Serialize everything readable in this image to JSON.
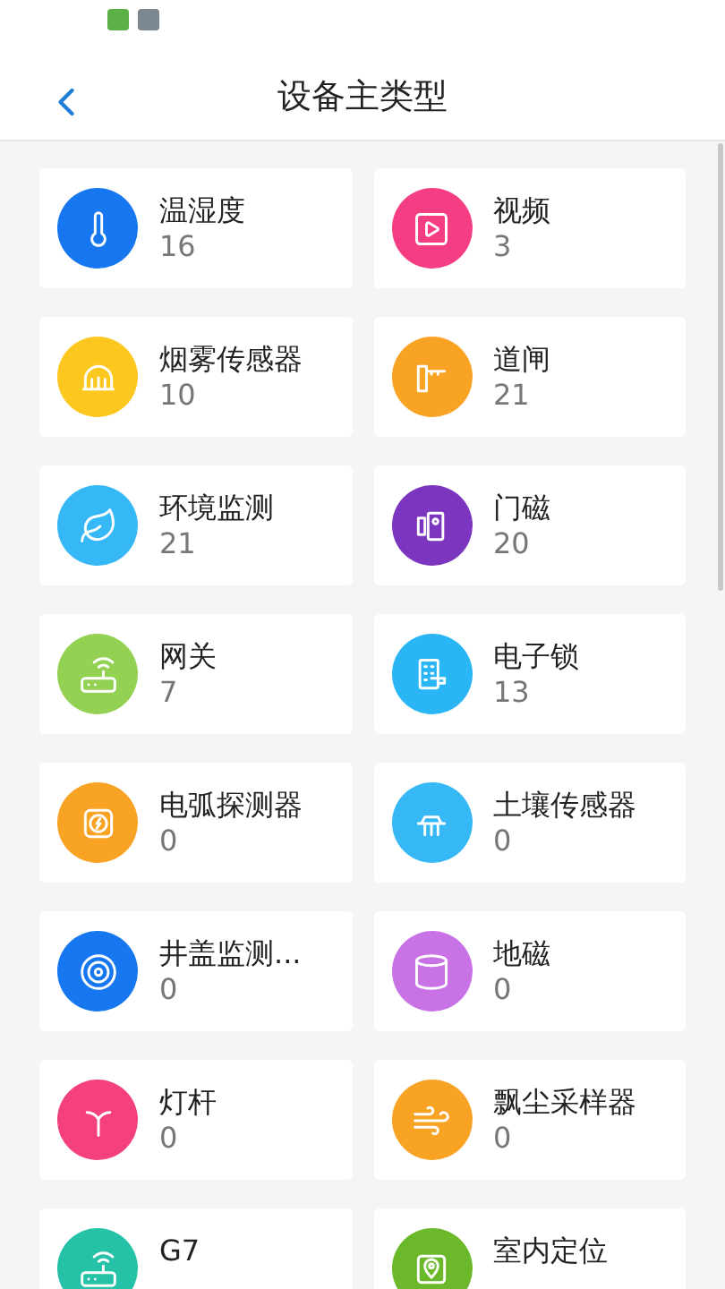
{
  "header": {
    "title": "设备主类型"
  },
  "device_types": [
    {
      "name": "温湿度",
      "count": "16",
      "color": "#1677f0"
    },
    {
      "name": "视频",
      "count": "3",
      "color": "#f53d84"
    },
    {
      "name": "烟雾传感器",
      "count": "10",
      "color": "#fcc820"
    },
    {
      "name": "道闸",
      "count": "21",
      "color": "#f9a325"
    },
    {
      "name": "环境监测",
      "count": "21",
      "color": "#35b8f5"
    },
    {
      "name": "门磁",
      "count": "20",
      "color": "#7b35be"
    },
    {
      "name": "网关",
      "count": "7",
      "color": "#93d152"
    },
    {
      "name": "电子锁",
      "count": "13",
      "color": "#2ab5f5"
    },
    {
      "name": "电弧探测器",
      "count": "0",
      "color": "#f9a325"
    },
    {
      "name": "土壤传感器",
      "count": "0",
      "color": "#35b8f5"
    },
    {
      "name": "井盖监测...",
      "count": "0",
      "color": "#1677f0"
    },
    {
      "name": "地磁",
      "count": "0",
      "color": "#c872e6"
    },
    {
      "name": "灯杆",
      "count": "0",
      "color": "#f5407e"
    },
    {
      "name": "飘尘采样器",
      "count": "0",
      "color": "#f9a325"
    },
    {
      "name": "G7",
      "color": "#26c2a8"
    },
    {
      "name": "室内定位",
      "color": "#6bb82b"
    }
  ]
}
